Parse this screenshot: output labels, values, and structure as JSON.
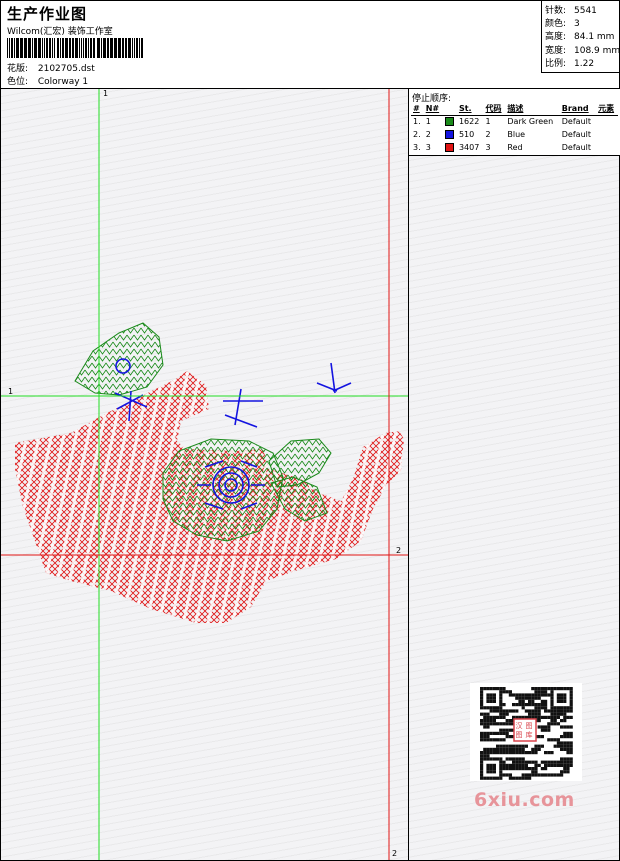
{
  "header": {
    "title": "生产作业图",
    "company": "Wilcom(汇宏) 装饰工作室",
    "design_label": "花版:",
    "design_value": "2102705.dst",
    "colorway_label": "色位:",
    "colorway_value": "Colorway 1"
  },
  "stats": [
    {
      "label": "针数:",
      "value": "5541"
    },
    {
      "label": "颜色:",
      "value": "3"
    },
    {
      "label": "高度:",
      "value": "84.1 mm"
    },
    {
      "label": "宽度:",
      "value": "108.9 mm"
    },
    {
      "label": "比例:",
      "value": "1.22"
    }
  ],
  "stop_sequence": {
    "title": "停止顺序:",
    "headers": [
      "#",
      "N#",
      "St.",
      "代码",
      "描述",
      "Brand",
      "元素"
    ],
    "rows": [
      {
        "index": "1.",
        "n": "1",
        "color": "#1a8a1a",
        "stitches": "1622",
        "code": "1",
        "description": "Dark Green",
        "brand": "Default"
      },
      {
        "index": "2.",
        "n": "2",
        "color": "#1414e0",
        "stitches": "510",
        "code": "2",
        "description": "Blue",
        "brand": "Default"
      },
      {
        "index": "3.",
        "n": "3",
        "color": "#e01414",
        "stitches": "3407",
        "code": "3",
        "description": "Red",
        "brand": "Default"
      }
    ]
  },
  "guides": {
    "v1_label": "1",
    "h1_label": "1",
    "h2_label": "2",
    "v2_label": "2",
    "green": "#22dd22",
    "red": "#e01414"
  },
  "watermark": {
    "text": "6xiu.com",
    "seal_text": "汉图图库"
  }
}
